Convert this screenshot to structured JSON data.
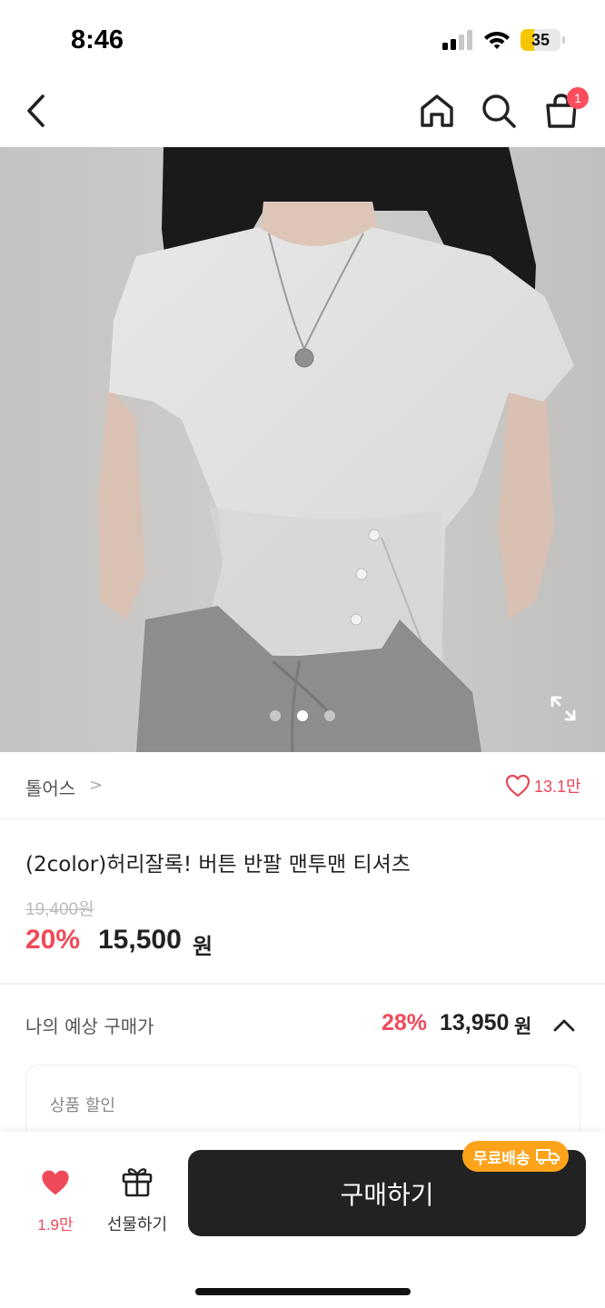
{
  "status_bar": {
    "time": "8:46",
    "battery": "35",
    "battery_level": 0.35
  },
  "nav": {
    "cart_badge": "1"
  },
  "image": {
    "page_count": 3,
    "active_index": 1
  },
  "shop": {
    "name": "톨어스",
    "chevron": ">",
    "like_count": "13.1만"
  },
  "product": {
    "title": "(2color)허리잘록! 버튼 반팔 맨투맨 티셔츠",
    "original_price": "19,400원",
    "discount_rate": "20%",
    "sale_price": "15,500",
    "price_unit": "원"
  },
  "expected": {
    "label": "나의 예상 구매가",
    "rate": "28%",
    "price": "13,950",
    "unit": "원"
  },
  "discount_section": {
    "label": "상품 할인"
  },
  "bottom_bar": {
    "wish_count": "1.9만",
    "gift_label": "선물하기",
    "buy_label": "구매하기",
    "free_shipping": "무료배송"
  },
  "colors": {
    "accent": "#ef4a5a",
    "buy_button": "#222222",
    "free_shipping": "#ffa31a",
    "battery": "#f6c700"
  }
}
